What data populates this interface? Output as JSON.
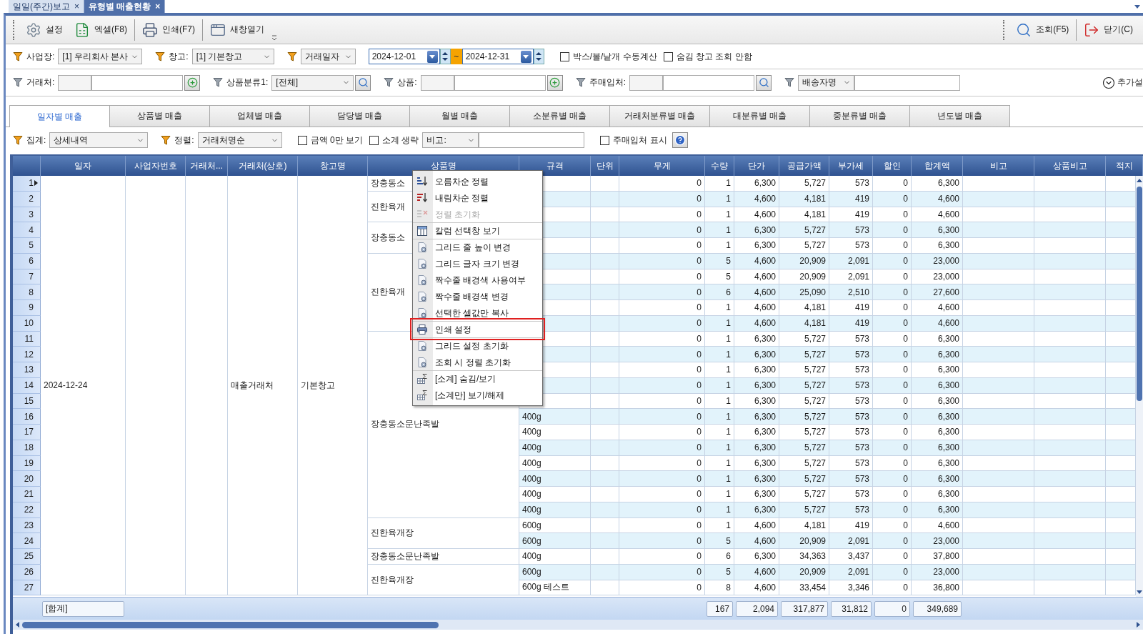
{
  "document_tabs": [
    {
      "label": "일일(주간)보고",
      "close": "×",
      "selected": false
    },
    {
      "label": "유형별 매출현황",
      "close": "×",
      "selected": true
    }
  ],
  "toolbar": {
    "left": [
      {
        "kind": "settings",
        "label": "설정"
      },
      {
        "kind": "excel",
        "label": "엑셀(F8)"
      },
      {
        "kind": "print",
        "label": "인쇄(F7)"
      },
      {
        "kind": "window",
        "label": "새창열기"
      }
    ],
    "right": [
      {
        "kind": "search",
        "label": "조회(F5)"
      },
      {
        "kind": "exit",
        "label": "닫기(C)"
      }
    ]
  },
  "filters_1": [
    {
      "kind": "combo",
      "filter": true,
      "label": "사업장:",
      "value": "[1] 우리회사 본사"
    },
    {
      "kind": "combo",
      "filter": true,
      "label": "창고:",
      "value": "[1] 기본창고"
    },
    {
      "kind": "combo",
      "filter": true,
      "value": "거래일자"
    },
    {
      "kind": "date_range",
      "from": "2024-12-01",
      "separator": "~",
      "to": "2024-12-31"
    },
    {
      "kind": "checkbox",
      "label": "박스/볼/낱개 수동계산",
      "checked": false
    },
    {
      "kind": "checkbox",
      "label": "숨김 창고 조회 안함",
      "checked": false
    }
  ],
  "filters_2": [
    {
      "kind": "lookup",
      "filter": true,
      "label": "거래처:",
      "button": {
        "kind": "add"
      }
    },
    {
      "kind": "combo",
      "filter": true,
      "label": "상품분류1:",
      "value": "[전체]",
      "button": {
        "kind": "search"
      }
    },
    {
      "kind": "lookup",
      "filter": true,
      "label": "상품:",
      "button": {
        "kind": "add"
      }
    },
    {
      "kind": "lookup",
      "filter": true,
      "label": "주매입처:",
      "button": {
        "kind": "search"
      }
    },
    {
      "kind": "combo_input",
      "filter": true,
      "value": "배송자명"
    }
  ],
  "more_settings": {
    "label": "추가설"
  },
  "tabs": [
    {
      "label": "일자별 매출",
      "selected": true
    },
    {
      "label": "상품별 매출",
      "selected": false
    },
    {
      "label": "업체별 매출",
      "selected": false
    },
    {
      "label": "담당별 매출",
      "selected": false
    },
    {
      "label": "월별 매출",
      "selected": false
    },
    {
      "label": "소분류별 매출",
      "selected": false
    },
    {
      "label": "거래처분류별 매출",
      "selected": false
    },
    {
      "label": "대분류별 매출",
      "selected": false
    },
    {
      "label": "중분류별 매출",
      "selected": false
    },
    {
      "label": "년도별 매출",
      "selected": false
    }
  ],
  "options": [
    {
      "kind": "combo",
      "filter": true,
      "label": "집계:",
      "value": "상세내역"
    },
    {
      "kind": "combo",
      "filter": true,
      "label": "정렬:",
      "value": "거래처명순"
    },
    {
      "kind": "checkbox",
      "label": "금액 0만 보기",
      "checked": false
    },
    {
      "kind": "checkbox",
      "label": "소계 생략",
      "checked": false
    },
    {
      "kind": "combo_input",
      "filter": false,
      "value": "비고:"
    },
    {
      "kind": "checkbox",
      "label": "주매입처 표시",
      "checked": false
    }
  ],
  "grid": {
    "columns": [
      "일자",
      "사업자번호",
      "거래처...",
      "거래처(상호)",
      "창고명",
      "상품명",
      "규격",
      "단위",
      "무게",
      "수량",
      "단가",
      "공급가액",
      "부가세",
      "할인",
      "합계액",
      "비고",
      "상품비고",
      "적지"
    ],
    "merged": {
      "date": "2024-12-24",
      "customer": "매출거래처",
      "warehouse": "기본창고"
    },
    "product_groups": [
      {
        "product": "장충동소",
        "rows": [
          {
            "num": "1",
            "current": true,
            "weight": "0",
            "qty": "1",
            "price": "6,300",
            "supply": "5,727",
            "vat": "573",
            "discount": "0",
            "total": "6,300"
          }
        ]
      },
      {
        "product": "진한육개",
        "rows": [
          {
            "num": "2",
            "current": false,
            "weight": "0",
            "qty": "1",
            "price": "4,600",
            "supply": "4,181",
            "vat": "419",
            "discount": "0",
            "total": "4,600"
          },
          {
            "num": "3",
            "current": false,
            "weight": "0",
            "qty": "1",
            "price": "4,600",
            "supply": "4,181",
            "vat": "419",
            "discount": "0",
            "total": "4,600"
          }
        ]
      },
      {
        "product": "장충동소",
        "rows": [
          {
            "num": "4",
            "current": false,
            "weight": "0",
            "qty": "1",
            "price": "6,300",
            "supply": "5,727",
            "vat": "573",
            "discount": "0",
            "total": "6,300"
          },
          {
            "num": "5",
            "current": false,
            "weight": "0",
            "qty": "1",
            "price": "6,300",
            "supply": "5,727",
            "vat": "573",
            "discount": "0",
            "total": "6,300"
          }
        ]
      },
      {
        "product": "진한육개",
        "rows": [
          {
            "num": "6",
            "current": false,
            "weight": "0",
            "qty": "5",
            "price": "4,600",
            "supply": "20,909",
            "vat": "2,091",
            "discount": "0",
            "total": "23,000"
          },
          {
            "num": "7",
            "current": false,
            "weight": "0",
            "qty": "5",
            "price": "4,600",
            "supply": "20,909",
            "vat": "2,091",
            "discount": "0",
            "total": "23,000"
          },
          {
            "num": "8",
            "current": false,
            "weight": "0",
            "qty": "6",
            "price": "4,600",
            "supply": "25,090",
            "vat": "2,510",
            "discount": "0",
            "total": "27,600"
          },
          {
            "num": "9",
            "current": false,
            "weight": "0",
            "qty": "1",
            "price": "4,600",
            "supply": "4,181",
            "vat": "419",
            "discount": "0",
            "total": "4,600"
          },
          {
            "num": "10",
            "current": false,
            "weight": "0",
            "qty": "1",
            "price": "4,600",
            "supply": "4,181",
            "vat": "419",
            "discount": "0",
            "total": "4,600"
          }
        ]
      },
      {
        "product": "장충동소문난족발",
        "rows": [
          {
            "num": "11",
            "current": false,
            "weight": "0",
            "qty": "1",
            "price": "6,300",
            "supply": "5,727",
            "vat": "573",
            "discount": "0",
            "total": "6,300"
          },
          {
            "num": "12",
            "current": false,
            "weight": "0",
            "qty": "1",
            "price": "6,300",
            "supply": "5,727",
            "vat": "573",
            "discount": "0",
            "total": "6,300"
          },
          {
            "num": "13",
            "current": false,
            "weight": "0",
            "qty": "1",
            "price": "6,300",
            "supply": "5,727",
            "vat": "573",
            "discount": "0",
            "total": "6,300"
          },
          {
            "num": "14",
            "current": false,
            "weight": "0",
            "qty": "1",
            "price": "6,300",
            "supply": "5,727",
            "vat": "573",
            "discount": "0",
            "total": "6,300"
          },
          {
            "num": "15",
            "current": false,
            "weight": "0",
            "qty": "1",
            "price": "6,300",
            "supply": "5,727",
            "vat": "573",
            "discount": "0",
            "total": "6,300"
          },
          {
            "num": "16",
            "current": false,
            "spec": "400g",
            "weight": "0",
            "qty": "1",
            "price": "6,300",
            "supply": "5,727",
            "vat": "573",
            "discount": "0",
            "total": "6,300"
          },
          {
            "num": "17",
            "current": false,
            "spec": "400g",
            "weight": "0",
            "qty": "1",
            "price": "6,300",
            "supply": "5,727",
            "vat": "573",
            "discount": "0",
            "total": "6,300"
          },
          {
            "num": "18",
            "current": false,
            "spec": "400g",
            "weight": "0",
            "qty": "1",
            "price": "6,300",
            "supply": "5,727",
            "vat": "573",
            "discount": "0",
            "total": "6,300"
          },
          {
            "num": "19",
            "current": false,
            "spec": "400g",
            "weight": "0",
            "qty": "1",
            "price": "6,300",
            "supply": "5,727",
            "vat": "573",
            "discount": "0",
            "total": "6,300"
          },
          {
            "num": "20",
            "current": false,
            "spec": "400g",
            "weight": "0",
            "qty": "1",
            "price": "6,300",
            "supply": "5,727",
            "vat": "573",
            "discount": "0",
            "total": "6,300"
          },
          {
            "num": "21",
            "current": false,
            "spec": "400g",
            "weight": "0",
            "qty": "1",
            "price": "6,300",
            "supply": "5,727",
            "vat": "573",
            "discount": "0",
            "total": "6,300"
          },
          {
            "num": "22",
            "current": false,
            "spec": "400g",
            "weight": "0",
            "qty": "1",
            "price": "6,300",
            "supply": "5,727",
            "vat": "573",
            "discount": "0",
            "total": "6,300"
          }
        ]
      },
      {
        "product": "진한육개장",
        "rows": [
          {
            "num": "23",
            "current": false,
            "spec": "600g",
            "weight": "0",
            "qty": "1",
            "price": "4,600",
            "supply": "4,181",
            "vat": "419",
            "discount": "0",
            "total": "4,600"
          },
          {
            "num": "24",
            "current": false,
            "spec": "600g",
            "weight": "0",
            "qty": "5",
            "price": "4,600",
            "supply": "20,909",
            "vat": "2,091",
            "discount": "0",
            "total": "23,000"
          }
        ]
      },
      {
        "product": "장충동소문난족발",
        "rows": [
          {
            "num": "25",
            "current": false,
            "spec": "400g",
            "weight": "0",
            "qty": "6",
            "price": "6,300",
            "supply": "34,363",
            "vat": "3,437",
            "discount": "0",
            "total": "37,800"
          }
        ]
      },
      {
        "product": "진한육개장",
        "rows": [
          {
            "num": "26",
            "current": false,
            "spec": "600g",
            "weight": "0",
            "qty": "5",
            "price": "4,600",
            "supply": "20,909",
            "vat": "2,091",
            "discount": "0",
            "total": "23,000"
          },
          {
            "num": "27",
            "current": false,
            "spec": "600g 테스트",
            "weight": "0",
            "qty": "8",
            "price": "4,600",
            "supply": "33,454",
            "vat": "3,346",
            "discount": "0",
            "total": "36,800"
          }
        ]
      }
    ],
    "totals": {
      "date": "[합계]",
      "qty": "167",
      "price": "2,094",
      "supply": "317,877",
      "vat": "31,812",
      "discount": "0",
      "total": "349,689"
    }
  },
  "context_menu": {
    "items": [
      {
        "kind": "sort-asc",
        "label": "오름차순 정렬",
        "disabled": false,
        "divider_above": false,
        "highlighted": false
      },
      {
        "kind": "sort-desc",
        "label": "내림차순 정렬",
        "disabled": false,
        "divider_above": false,
        "highlighted": false
      },
      {
        "kind": "sort-clear",
        "label": "정렬 초기화",
        "disabled": true,
        "divider_above": false,
        "highlighted": false
      },
      {
        "kind": "columns",
        "label": "칼럼 선택창 보기",
        "disabled": false,
        "divider_above": true,
        "highlighted": false
      },
      {
        "kind": "gear",
        "label": "그리드 줄 높이 변경",
        "disabled": false,
        "divider_above": true,
        "highlighted": false
      },
      {
        "kind": "gear",
        "label": "그리드 글자 크기 변경",
        "disabled": false,
        "divider_above": false,
        "highlighted": false
      },
      {
        "kind": "gear",
        "label": "짝수줄 배경색 사용여부",
        "disabled": false,
        "divider_above": false,
        "highlighted": false
      },
      {
        "kind": "gear",
        "label": "짝수줄 배경색 변경",
        "disabled": false,
        "divider_above": false,
        "highlighted": false
      },
      {
        "kind": "gear",
        "label": "선택한 셀값만 복사",
        "disabled": false,
        "divider_above": false,
        "highlighted": false
      },
      {
        "kind": "print",
        "label": "인쇄 설정",
        "disabled": false,
        "divider_above": true,
        "highlighted": true
      },
      {
        "kind": "gear",
        "label": "그리드 설정 초기화",
        "disabled": false,
        "divider_above": true,
        "highlighted": false
      },
      {
        "kind": "gear",
        "label": "조회 시 정렬 초기화",
        "disabled": false,
        "divider_above": false,
        "highlighted": false
      },
      {
        "kind": "subtotal",
        "label": "[소계] 숨김/보기",
        "disabled": false,
        "divider_above": true,
        "highlighted": false
      },
      {
        "kind": "subtotal",
        "label": "[소계만] 보기/해제",
        "disabled": false,
        "divider_above": false,
        "highlighted": false
      }
    ]
  }
}
